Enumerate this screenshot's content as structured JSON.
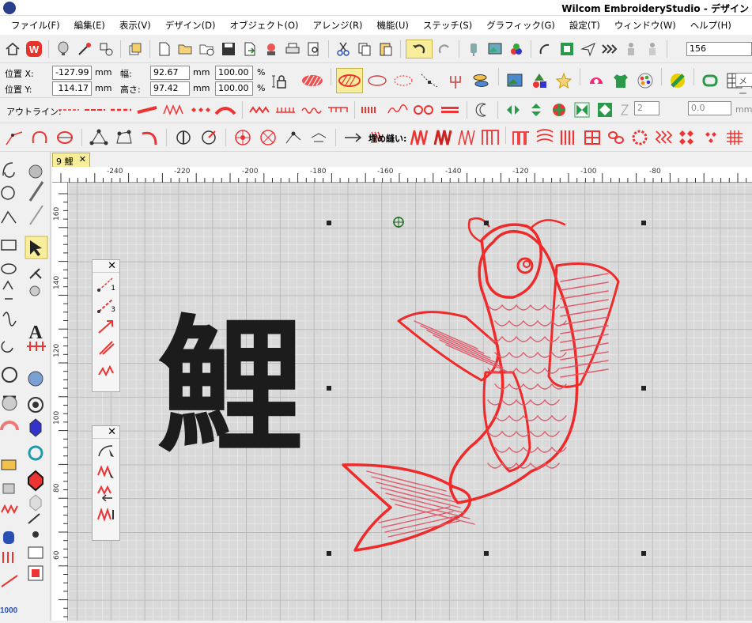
{
  "window": {
    "title": "Wilcom EmbroideryStudio - デザイン"
  },
  "menu": [
    "ファイル(F)",
    "編集(E)",
    "表示(V)",
    "デザイン(D)",
    "オブジェクト(O)",
    "アレンジ(R)",
    "機能(U)",
    "ステッチ(S)",
    "グラフィック(G)",
    "設定(T)",
    "ウィンドウ(W)",
    "ヘルプ(H)"
  ],
  "toolbar_main": {
    "stitch_count_value": "156"
  },
  "props": {
    "pos_x_label": "位置 X:",
    "pos_x_value": "-127.99",
    "pos_y_label": "位置 Y:",
    "pos_y_value": "114.17",
    "width_label": "幅:",
    "width_value": "92.67",
    "height_label": "高さ:",
    "height_value": "97.42",
    "unit_mm": "mm",
    "scale_w": "100.00",
    "scale_h": "100.00",
    "unit_pct": "%",
    "method_hint": "メート"
  },
  "outline_bar": {
    "label": "アウトライン:",
    "spin1": "2",
    "spin2": "0.0",
    "spin2_unit": "mm"
  },
  "fill_bar": {
    "label": "埋め縫い:"
  },
  "document": {
    "tab_label": "9 鯉",
    "close_glyph": "✕"
  },
  "ruler": {
    "h_ticks": [
      "-240",
      "-220",
      "-200",
      "-180",
      "-160",
      "-140",
      "-120",
      "-100",
      "-80"
    ],
    "v_ticks": [
      "160",
      "140",
      "120",
      "100",
      "80",
      "60"
    ]
  },
  "canvas": {
    "kanji": "鯉",
    "colors": {
      "kanji": "#1c1c1c",
      "fish_outline": "#ee2a2a",
      "fish_fill": "#e05a6a",
      "accent": "#c91f1f"
    }
  },
  "panels": {
    "close_glyph": "✕",
    "p1_items": [
      "1",
      "3"
    ]
  },
  "leftbar": {
    "counter": "1000"
  }
}
